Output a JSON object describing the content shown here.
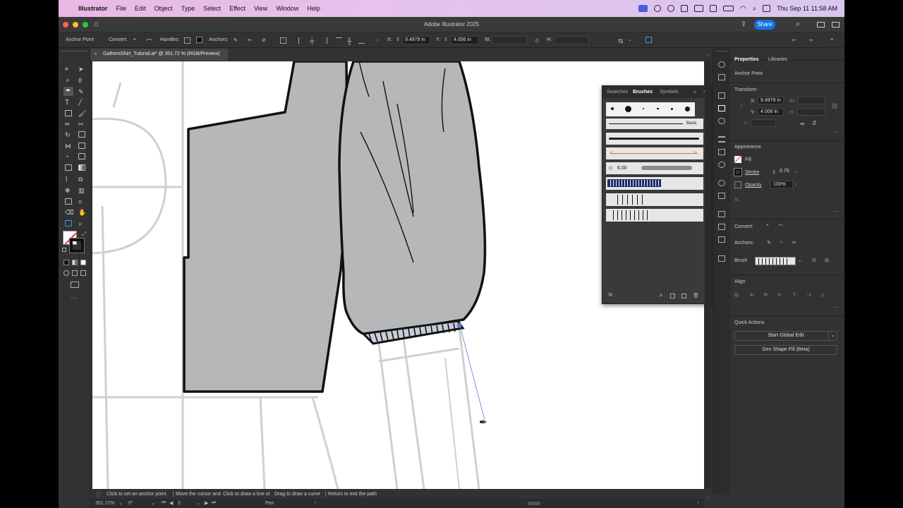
{
  "menubar": {
    "app": "Illustrator",
    "items": [
      "File",
      "Edit",
      "Object",
      "Type",
      "Select",
      "Effect",
      "View",
      "Window",
      "Help"
    ],
    "clock": "Thu Sep 11  11:58 AM"
  },
  "window": {
    "title": "Adobe Illustrator 2025",
    "share": "Share"
  },
  "control": {
    "mode": "Anchor Point",
    "convert": "Convert:",
    "handles": "Handles:",
    "anchors": "Anchors:",
    "x_label": "X:",
    "x_value": "9.4979 in",
    "y_label": "Y:",
    "y_value": "4.006 in",
    "w_label": "W:",
    "h_label": "H:"
  },
  "document": {
    "tab": "GathersShirt_Tutorial.ai* @ 351.72 % (RGB/Preview)",
    "close": "×"
  },
  "brushes": {
    "tabs": [
      "Swatches",
      "Brushes",
      "Symbols"
    ],
    "basic": "Basic",
    "size": "6.00"
  },
  "properties": {
    "tabs": [
      "Properties",
      "Libraries"
    ],
    "selection": "Anchor Point",
    "transform": "Transform",
    "x_label": "X:",
    "x_value": "9.4979 in",
    "y_label": "Y:",
    "y_value": "4.006 in",
    "w_label": "W:",
    "h_label": "H:",
    "appearance": "Appearance",
    "fill": "Fill",
    "stroke": "Stroke",
    "stroke_value": "0.75",
    "opacity": "Opacity",
    "opacity_value": "100%",
    "fx": "fx.",
    "convert": "Convert:",
    "anchors": "Anchors:",
    "brush": "Brush",
    "align": "Align",
    "quick_actions": "Quick Actions",
    "start_global_edit": "Start Global Edit",
    "gen_shape_fill": "Gen Shape Fill (Beta)"
  },
  "status": {
    "hint_a": "Click to set an anchor point",
    "hint_b": "Move the cursor and",
    "hint_c": "Click to draw a line or",
    "hint_d": "Drag to draw a curve",
    "hint_e": "Return to exit the path",
    "zoom": "351.72%",
    "angle": "0°",
    "artboard": "2",
    "tool": "Pen"
  },
  "colors": {
    "accent": "#1473e6",
    "shirt": "#b5b7b9",
    "canvas": "#ffffff",
    "panel": "#323232"
  }
}
